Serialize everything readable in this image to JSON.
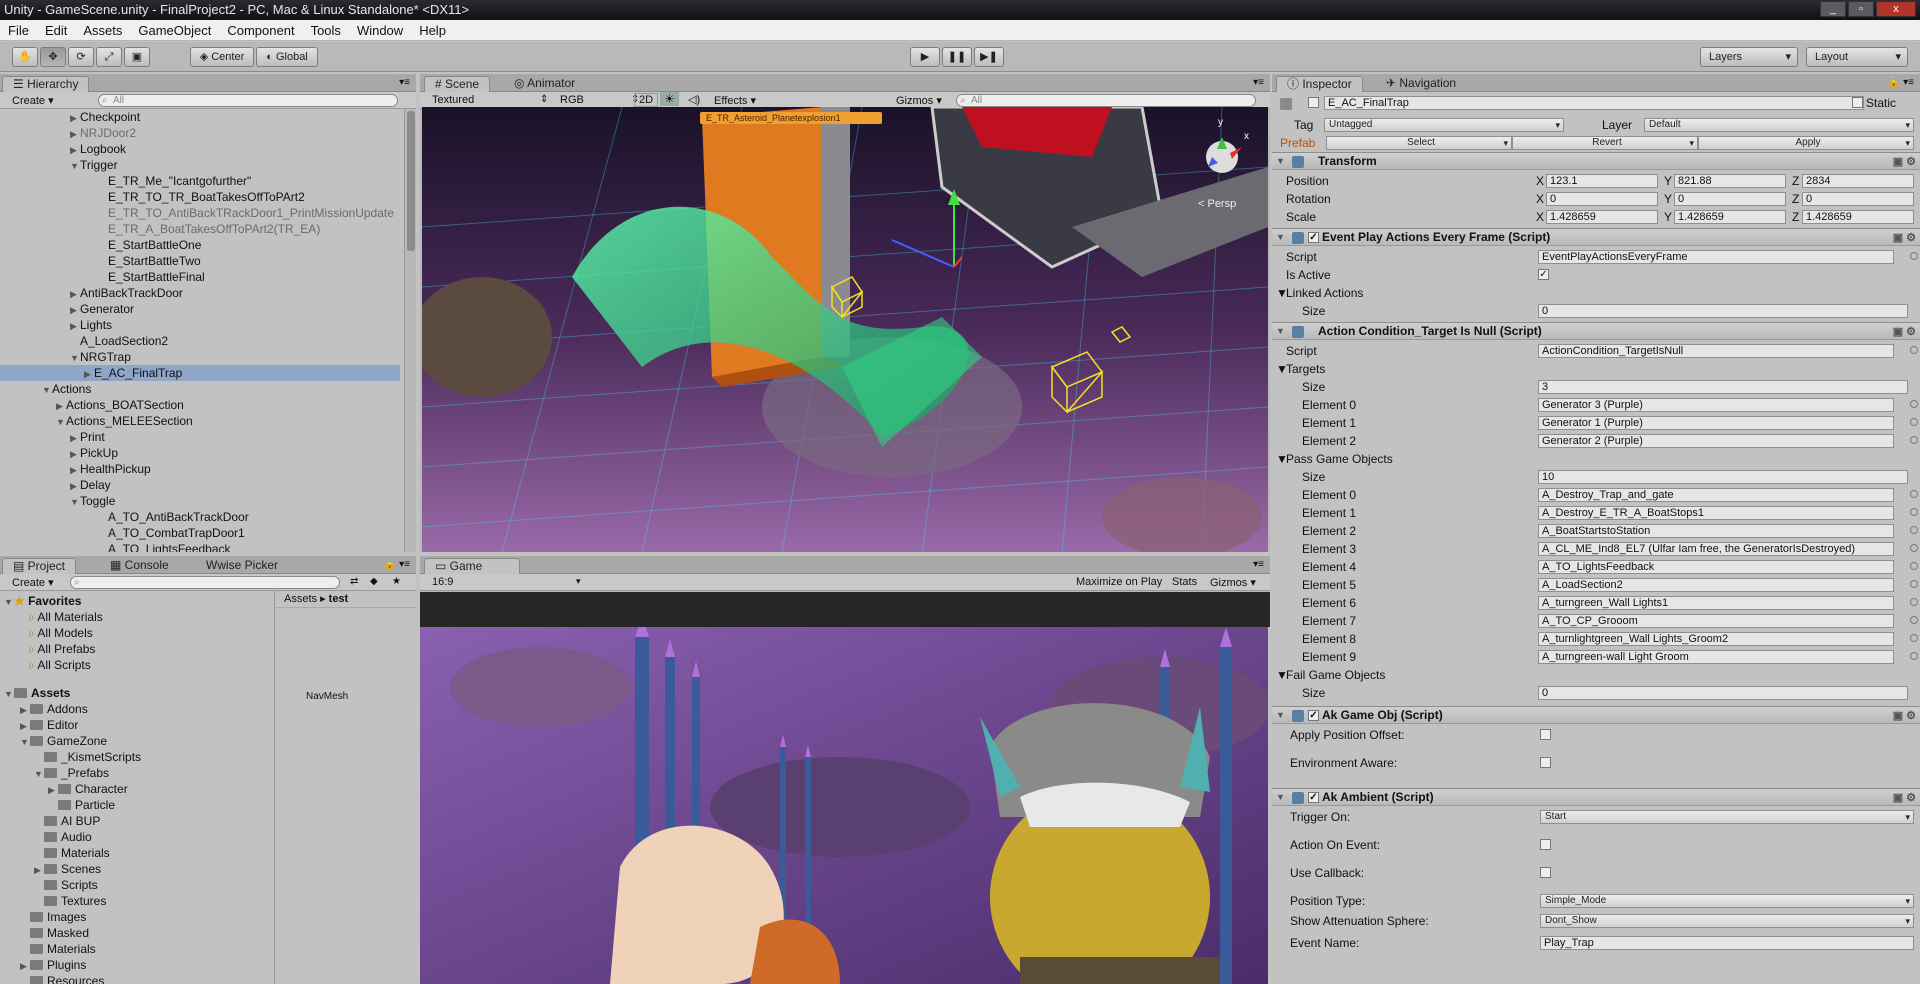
{
  "window": {
    "title": "Unity - GameScene.unity - FinalProject2 - PC, Mac & Linux Standalone* <DX11>",
    "min": "_",
    "max": "▫",
    "close": "x"
  },
  "menu": [
    "File",
    "Edit",
    "Assets",
    "GameObject",
    "Component",
    "Tools",
    "Window",
    "Help"
  ],
  "toolbar": {
    "center": "Center",
    "global": "Global",
    "layers": "Layers",
    "layout": "Layout",
    "play": "▶",
    "pause": "❚❚",
    "step": "▶❚"
  },
  "hierarchy": {
    "tab": "Hierarchy",
    "create": "Create ▾",
    "search": "All",
    "rows": [
      {
        "label": "Checkpoint",
        "indent": 5,
        "arrow": "▶",
        "dim": false,
        "sel": false
      },
      {
        "label": "NRJDoor2",
        "indent": 5,
        "arrow": "▶",
        "dim": true,
        "sel": false
      },
      {
        "label": "Logbook",
        "indent": 5,
        "arrow": "▶",
        "dim": false,
        "sel": false
      },
      {
        "label": "Trigger",
        "indent": 5,
        "arrow": "▼",
        "dim": false,
        "sel": false
      },
      {
        "label": "E_TR_Me_\"Icantgofurther\"",
        "indent": 7,
        "arrow": "",
        "dim": false,
        "sel": false
      },
      {
        "label": "E_TR_TO_TR_BoatTakesOffToPArt2",
        "indent": 7,
        "arrow": "",
        "dim": false,
        "sel": false
      },
      {
        "label": "E_TR_TO_AntiBackTRackDoor1_PrintMissionUpdate",
        "indent": 7,
        "arrow": "",
        "dim": true,
        "sel": false
      },
      {
        "label": "E_TR_A_BoatTakesOffToPArt2(TR_EA)",
        "indent": 7,
        "arrow": "",
        "dim": true,
        "sel": false
      },
      {
        "label": "E_StartBattleOne",
        "indent": 7,
        "arrow": "",
        "dim": false,
        "sel": false
      },
      {
        "label": "E_StartBattleTwo",
        "indent": 7,
        "arrow": "",
        "dim": false,
        "sel": false
      },
      {
        "label": "E_StartBattleFinal",
        "indent": 7,
        "arrow": "",
        "dim": false,
        "sel": false
      },
      {
        "label": "AntiBackTrackDoor",
        "indent": 5,
        "arrow": "▶",
        "dim": false,
        "sel": false
      },
      {
        "label": "Generator",
        "indent": 5,
        "arrow": "▶",
        "dim": false,
        "sel": false
      },
      {
        "label": "Lights",
        "indent": 5,
        "arrow": "▶",
        "dim": false,
        "sel": false
      },
      {
        "label": "A_LoadSection2",
        "indent": 5,
        "arrow": "",
        "dim": false,
        "sel": false
      },
      {
        "label": "NRGTrap",
        "indent": 5,
        "arrow": "▼",
        "dim": false,
        "sel": false
      },
      {
        "label": "E_AC_FinalTrap",
        "indent": 6,
        "arrow": "▶",
        "dim": false,
        "sel": true
      },
      {
        "label": "Actions",
        "indent": 3,
        "arrow": "▼",
        "dim": false,
        "sel": false
      },
      {
        "label": "Actions_BOATSection",
        "indent": 4,
        "arrow": "▶",
        "dim": false,
        "sel": false
      },
      {
        "label": "Actions_MELEESection",
        "indent": 4,
        "arrow": "▼",
        "dim": false,
        "sel": false
      },
      {
        "label": "Print",
        "indent": 5,
        "arrow": "▶",
        "dim": false,
        "sel": false
      },
      {
        "label": "PickUp",
        "indent": 5,
        "arrow": "▶",
        "dim": false,
        "sel": false
      },
      {
        "label": "HealthPickup",
        "indent": 5,
        "arrow": "▶",
        "dim": false,
        "sel": false
      },
      {
        "label": "Delay",
        "indent": 5,
        "arrow": "▶",
        "dim": false,
        "sel": false
      },
      {
        "label": "Toggle",
        "indent": 5,
        "arrow": "▼",
        "dim": false,
        "sel": false
      },
      {
        "label": "A_TO_AntiBackTrackDoor",
        "indent": 7,
        "arrow": "",
        "dim": false,
        "sel": false
      },
      {
        "label": "A_TO_CombatTrapDoor1",
        "indent": 7,
        "arrow": "",
        "dim": false,
        "sel": false
      },
      {
        "label": "A_TO_LightsFeedback",
        "indent": 7,
        "arrow": "",
        "dim": false,
        "sel": false
      }
    ]
  },
  "scene": {
    "tabs": [
      "Scene",
      "Animator"
    ],
    "textured": "Textured",
    "rgb": "RGB",
    "mode2d": "2D",
    "effects": "Effects",
    "gizmos": "Gizmos",
    "search": "All",
    "label": "E_TR_Asteroid_Planetexplosion1",
    "persp": "< Persp",
    "axis_y": "y",
    "axis_x": "x"
  },
  "project": {
    "tabs": [
      "Project",
      "Console",
      "Wwise Picker"
    ],
    "create": "Create ▾",
    "breadcrumb": [
      "Assets",
      "test"
    ],
    "navmesh": "NavMesh",
    "favorites_title": "Favorites",
    "favorites": [
      "All Materials",
      "All Models",
      "All Prefabs",
      "All Scripts"
    ],
    "assets_title": "Assets",
    "tree": [
      {
        "label": "Addons",
        "indent": 1,
        "arrow": "▶"
      },
      {
        "label": "Editor",
        "indent": 1,
        "arrow": "▶"
      },
      {
        "label": "GameZone",
        "indent": 1,
        "arrow": "▼"
      },
      {
        "label": "_KismetScripts",
        "indent": 2,
        "arrow": ""
      },
      {
        "label": "_Prefabs",
        "indent": 2,
        "arrow": "▼"
      },
      {
        "label": "Character",
        "indent": 3,
        "arrow": "▶"
      },
      {
        "label": "Particle",
        "indent": 3,
        "arrow": ""
      },
      {
        "label": "AI BUP",
        "indent": 2,
        "arrow": ""
      },
      {
        "label": "Audio",
        "indent": 2,
        "arrow": ""
      },
      {
        "label": "Materials",
        "indent": 2,
        "arrow": ""
      },
      {
        "label": "Scenes",
        "indent": 2,
        "arrow": "▶"
      },
      {
        "label": "Scripts",
        "indent": 2,
        "arrow": ""
      },
      {
        "label": "Textures",
        "indent": 2,
        "arrow": ""
      },
      {
        "label": "Images",
        "indent": 1,
        "arrow": ""
      },
      {
        "label": "Masked",
        "indent": 1,
        "arrow": ""
      },
      {
        "label": "Materials",
        "indent": 1,
        "arrow": ""
      },
      {
        "label": "Plugins",
        "indent": 1,
        "arrow": "▶"
      },
      {
        "label": "Resources",
        "indent": 1,
        "arrow": ""
      }
    ]
  },
  "game": {
    "tab": "Game",
    "aspect": "16:9",
    "maximize": "Maximize on Play",
    "stats": "Stats",
    "gizmos": "Gizmos"
  },
  "inspector": {
    "tabs": [
      "Inspector",
      "Navigation"
    ],
    "object_name": "E_AC_FinalTrap",
    "static": "Static",
    "tag_label": "Tag",
    "tag": "Untagged",
    "layer_label": "Layer",
    "layer": "Default",
    "prefab": "Prefab",
    "select": "Select",
    "revert": "Revert",
    "apply": "Apply",
    "transform": {
      "title": "Transform",
      "position": {
        "label": "Position",
        "x": "123.1",
        "y": "821.88",
        "z": "2834"
      },
      "rotation": {
        "label": "Rotation",
        "x": "0",
        "y": "0",
        "z": "0"
      },
      "scale": {
        "label": "Scale",
        "x": "1.428659",
        "y": "1.428659",
        "z": "1.428659"
      }
    },
    "event_play": {
      "title": "Event Play Actions Every Frame (Script)",
      "script_label": "Script",
      "script": "EventPlayActionsEveryFrame",
      "active_label": "Is Active",
      "linked_label": "Linked Actions",
      "size_label": "Size",
      "size": "0"
    },
    "action_cond": {
      "title": "Action Condition_Target Is Null (Script)",
      "script_label": "Script",
      "script": "ActionCondition_TargetIsNull",
      "targets_label": "Targets",
      "size_label": "Size",
      "targets_size": "3",
      "targets": [
        {
          "label": "Element 0",
          "value": "Generator 3 (Purple)"
        },
        {
          "label": "Element 1",
          "value": "Generator 1 (Purple)"
        },
        {
          "label": "Element 2",
          "value": "Generator 2 (Purple)"
        }
      ],
      "pass_label": "Pass Game Objects",
      "pass_size": "10",
      "pass": [
        {
          "label": "Element 0",
          "value": "A_Destroy_Trap_and_gate"
        },
        {
          "label": "Element 1",
          "value": "A_Destroy_E_TR_A_BoatStops1"
        },
        {
          "label": "Element 2",
          "value": "A_BoatStartstoStation"
        },
        {
          "label": "Element 3",
          "value": "A_CL_ME_Ind8_EL7 (Ulfar Iam free, the GeneratorIsDestroyed)"
        },
        {
          "label": "Element 4",
          "value": "A_TO_LightsFeedback"
        },
        {
          "label": "Element 5",
          "value": "A_LoadSection2"
        },
        {
          "label": "Element 6",
          "value": "A_turngreen_Wall Lights1"
        },
        {
          "label": "Element 7",
          "value": "A_TO_CP_Grooom"
        },
        {
          "label": "Element 8",
          "value": "A_turnlightgreen_Wall Lights_Groom2"
        },
        {
          "label": "Element 9",
          "value": "A_turngreen-wall Light Groom"
        }
      ],
      "fail_label": "Fail Game Objects",
      "fail_size": "0"
    },
    "ak_game_obj": {
      "title": "Ak Game Obj (Script)",
      "offset_label": "Apply Position Offset:",
      "env_label": "Environment Aware:"
    },
    "ak_ambient": {
      "title": "Ak Ambient (Script)",
      "trigger_label": "Trigger On:",
      "trigger": "Start",
      "action_label": "Action On Event:",
      "callback_label": "Use Callback:",
      "position_label": "Position Type:",
      "position": "Simple_Mode",
      "sphere_label": "Show Attenuation Sphere:",
      "sphere": "Dont_Show",
      "event_label": "Event Name:",
      "event": "Play_Trap"
    }
  },
  "colors": {
    "selection": "#8fa6c8",
    "panel": "#c2c2c2",
    "accent_orange": "#f0a030",
    "grid_cyan": "#40e0ff"
  }
}
